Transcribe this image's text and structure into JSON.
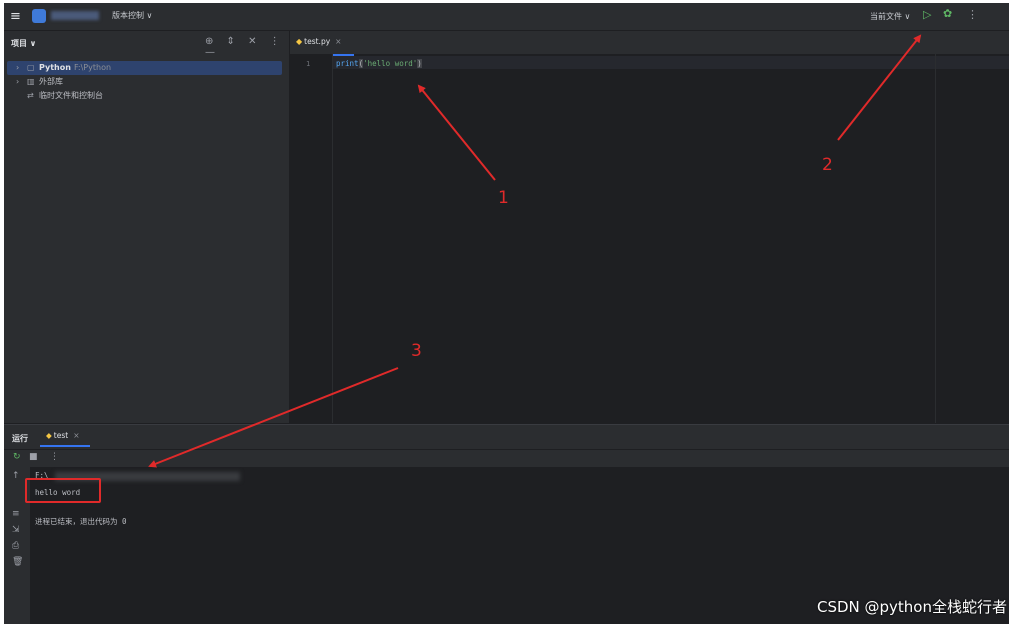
{
  "titlebar": {
    "menu_icon": "≡",
    "vcs_label": "版本控制 ∨",
    "run_config": "当前文件 ∨",
    "run_icon": "▷",
    "debug_icon": "✿",
    "more_icon": "⋮"
  },
  "project": {
    "header": "项目 ∨",
    "tools": "⊕ ⇕ ✕ ⋮ —",
    "items": [
      {
        "arrow": "›",
        "icon": "▢",
        "name": "Python",
        "path": "F:\\Python"
      },
      {
        "arrow": "›",
        "icon": "▥",
        "name": "外部库",
        "path": ""
      },
      {
        "arrow": "",
        "icon": "⇄",
        "name": "临时文件和控制台",
        "path": ""
      }
    ]
  },
  "editor": {
    "tab_icon": "◆",
    "tab_label": "test.py",
    "tab_close": "×",
    "line_number": "1",
    "code": {
      "fn": "print",
      "open": "(",
      "str": "'hello word'",
      "close": ")"
    }
  },
  "run": {
    "title": "运行",
    "tab_label": "test",
    "tab_close": "×",
    "tools": {
      "rerun": "↻",
      "stop": "■",
      "more": "⋮"
    },
    "side_icons": [
      "↑",
      "≡",
      "⇲",
      "⎙",
      "🗑"
    ],
    "console": {
      "first_line_prefix": "F:\\",
      "output": "hello word",
      "exit_message": "进程已结束，退出代码为 0"
    }
  },
  "annotations": {
    "labels": [
      "1",
      "2",
      "3"
    ],
    "color": "#e02a2a"
  },
  "watermark": "CSDN @python全栈蛇行者"
}
